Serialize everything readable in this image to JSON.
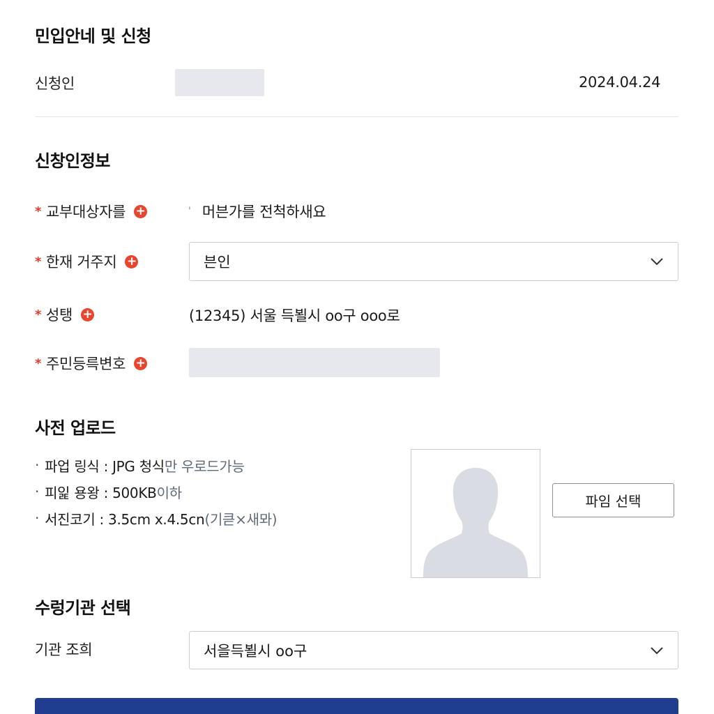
{
  "sections": {
    "guide_title": "민입안네 및 신청",
    "applicant_info_title": "신창인정보",
    "photo_upload_title": "사전 업로드",
    "agency_title": "수렁기관 선택"
  },
  "applicant": {
    "label": "신청인",
    "date": "2024.04.24"
  },
  "form": {
    "recipient": {
      "required_mark": "*",
      "label": "교부대상자를",
      "hint_mark": "'",
      "value": "머븐가를 전척하새요"
    },
    "residence": {
      "required_mark": "*",
      "label": "한재 거주지",
      "selected": "븐인"
    },
    "address": {
      "required_mark": "*",
      "label": "성탱",
      "value": "(12345) 서울 득뵐시 oo구 ooo로"
    },
    "resident_number": {
      "required_mark": "*",
      "label": "주민등륵변호"
    }
  },
  "photo": {
    "rules": [
      {
        "bullet": "·",
        "strong": "파업 링식 : JPG 청식",
        "muted": "만 우로드가능"
      },
      {
        "bullet": "·",
        "strong": "피잁 용왕 : 500KB",
        "muted": " 이하"
      },
      {
        "bullet": "·",
        "strong": "서진코기 : 3.5cm x.4.5cn",
        "muted": "(기큳×새뫄)"
      }
    ],
    "file_button_label": "파임 선택"
  },
  "agency": {
    "label": "기관 조희",
    "selected": "서을득뵐시 oo구"
  },
  "colors": {
    "primary": "#203e8f",
    "required": "#e03a2a",
    "masked_field": "#e6e8ee",
    "border": "#c9ced6"
  },
  "icons": {
    "add": "plus-circle-icon",
    "dropdown": "chevron-down-icon",
    "placeholder": "person-silhouette-icon"
  }
}
